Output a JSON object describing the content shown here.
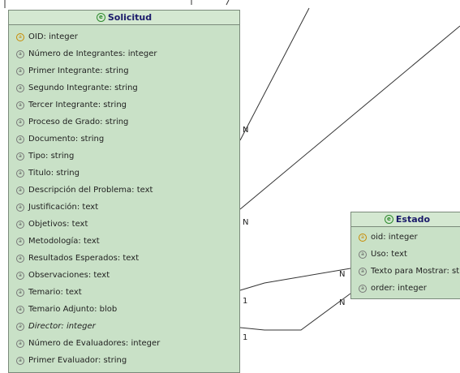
{
  "solicitud": {
    "title": "Solicitud",
    "attributes": [
      {
        "label": "OID: integer",
        "icon": "key-icon"
      },
      {
        "label": "Número de Integrantes: integer",
        "icon": "attribute-icon"
      },
      {
        "label": "Primer Integrante: string",
        "icon": "attribute-icon"
      },
      {
        "label": "Segundo Integrante: string",
        "icon": "attribute-icon"
      },
      {
        "label": "Tercer Integrante: string",
        "icon": "attribute-icon"
      },
      {
        "label": "Proceso de Grado: string",
        "icon": "attribute-icon"
      },
      {
        "label": "Documento: string",
        "icon": "attribute-icon"
      },
      {
        "label": "Tipo: string",
        "icon": "attribute-icon"
      },
      {
        "label": "Titulo: string",
        "icon": "attribute-icon"
      },
      {
        "label": "Descripción del Problema: text",
        "icon": "attribute-icon"
      },
      {
        "label": "Justificación: text",
        "icon": "attribute-icon"
      },
      {
        "label": "Objetivos: text",
        "icon": "attribute-icon"
      },
      {
        "label": "Metodología: text",
        "icon": "attribute-icon"
      },
      {
        "label": "Resultados Esperados: text",
        "icon": "attribute-icon"
      },
      {
        "label": "Observaciones: text",
        "icon": "attribute-icon"
      },
      {
        "label": "Temario: text",
        "icon": "attribute-icon"
      },
      {
        "label": "Temario Adjunto: blob",
        "icon": "attribute-icon"
      },
      {
        "label": "Director: integer",
        "icon": "derived-attribute-icon",
        "italic": true
      },
      {
        "label": "Número de Evaluadores: integer",
        "icon": "attribute-icon"
      },
      {
        "label": "Primer Evaluador: string",
        "icon": "attribute-icon"
      }
    ]
  },
  "estado": {
    "title": "Estado",
    "attributes": [
      {
        "label": "oid: integer",
        "icon": "key-icon"
      },
      {
        "label": "Uso: text",
        "icon": "attribute-icon"
      },
      {
        "label": "Texto para Mostrar: string",
        "icon": "attribute-icon"
      },
      {
        "label": "order: integer",
        "icon": "attribute-icon"
      }
    ]
  },
  "cardinalities": {
    "n1": "N",
    "n2": "N",
    "n3": "N",
    "n4": "N",
    "one1": "1",
    "one2": "1"
  },
  "colors": {
    "entity_fill": "#c9e1c7",
    "entity_border": "#7a8a7a",
    "header_text": "#1a1a6a",
    "line": "#333333"
  }
}
